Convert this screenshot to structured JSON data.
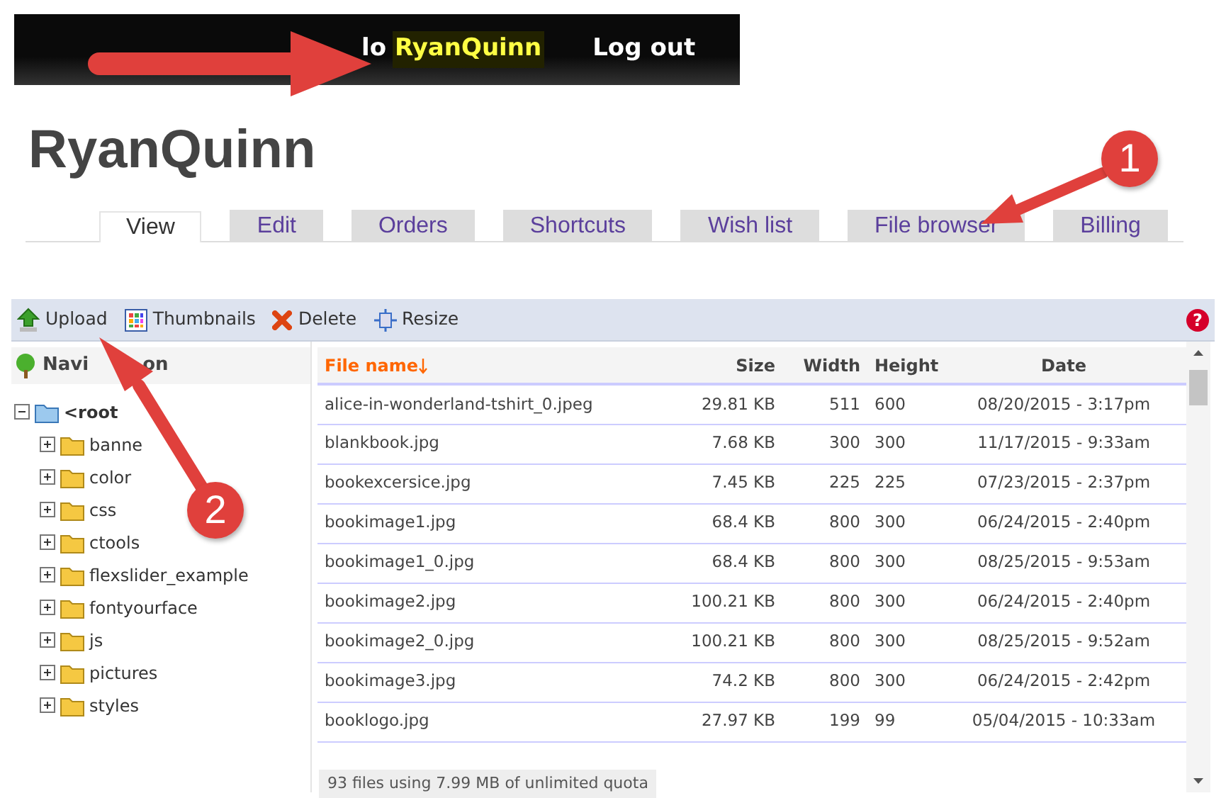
{
  "top_bar": {
    "greeting": "lo",
    "username": "RyanQuinn",
    "logout": "Log out"
  },
  "page_title": "RyanQuinn",
  "tabs": [
    {
      "label": "View",
      "selected": true
    },
    {
      "label": "Edit",
      "selected": false
    },
    {
      "label": "Orders",
      "selected": false
    },
    {
      "label": "Shortcuts",
      "selected": false
    },
    {
      "label": "Wish list",
      "selected": false
    },
    {
      "label": "File browser",
      "selected": false
    },
    {
      "label": "Billing",
      "selected": false
    }
  ],
  "toolbar": [
    {
      "kind": "upload",
      "label": "Upload"
    },
    {
      "kind": "thumbnails",
      "label": "Thumbnails"
    },
    {
      "kind": "delete",
      "label": "Delete"
    },
    {
      "kind": "resize",
      "label": "Resize"
    }
  ],
  "help": "?",
  "navigation": {
    "title_parts": [
      "Navi",
      "on"
    ],
    "tree": [
      {
        "label": "<root",
        "expanded": true,
        "children": [
          {
            "label": "banne",
            "expanded": false
          },
          {
            "label": "color",
            "expanded": false
          },
          {
            "label": "css",
            "expanded": false
          },
          {
            "label": "ctools",
            "expanded": false
          },
          {
            "label": "flexslider_example",
            "expanded": false
          },
          {
            "label": "fontyourface",
            "expanded": false
          },
          {
            "label": "js",
            "expanded": false
          },
          {
            "label": "pictures",
            "expanded": false
          },
          {
            "label": "styles",
            "expanded": false
          }
        ]
      }
    ]
  },
  "table": {
    "columns": [
      {
        "label": "File name",
        "sorted": true
      },
      {
        "label": "Size",
        "sorted": false
      },
      {
        "label": "Width",
        "sorted": false
      },
      {
        "label": "Height",
        "sorted": false
      },
      {
        "label": "Date",
        "sorted": false
      }
    ],
    "rows": [
      [
        "alice-in-wonderland-tshirt_0.jpeg",
        "29.81 KB",
        "511",
        "600",
        "08/20/2015 - 3:17pm"
      ],
      [
        "blankbook.jpg",
        "7.68 KB",
        "300",
        "300",
        "11/17/2015 - 9:33am"
      ],
      [
        "bookexcersice.jpg",
        "7.45 KB",
        "225",
        "225",
        "07/23/2015 - 2:37pm"
      ],
      [
        "bookimage1.jpg",
        "68.4 KB",
        "800",
        "300",
        "06/24/2015 - 2:40pm"
      ],
      [
        "bookimage1_0.jpg",
        "68.4 KB",
        "800",
        "300",
        "08/25/2015 - 9:53am"
      ],
      [
        "bookimage2.jpg",
        "100.21 KB",
        "800",
        "300",
        "06/24/2015 - 2:40pm"
      ],
      [
        "bookimage2_0.jpg",
        "100.21 KB",
        "800",
        "300",
        "08/25/2015 - 9:52am"
      ],
      [
        "bookimage3.jpg",
        "74.2 KB",
        "800",
        "300",
        "06/24/2015 - 2:42pm"
      ],
      [
        "booklogo.jpg",
        "27.97 KB",
        "199",
        "99",
        "05/04/2015 - 10:33am"
      ]
    ]
  },
  "status": "93 files using 7.99 MB of unlimited quota",
  "callouts": [
    {
      "number": "1"
    },
    {
      "number": "2"
    }
  ]
}
